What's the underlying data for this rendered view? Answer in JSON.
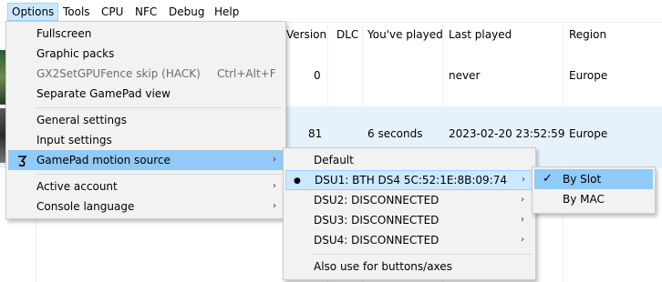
{
  "menubar": {
    "items": [
      "Options",
      "Tools",
      "CPU",
      "NFC",
      "Debug",
      "Help"
    ]
  },
  "gamelist": {
    "columns": [
      "Version",
      "DLC",
      "You've played",
      "Last played",
      "Region"
    ],
    "rows": [
      {
        "version": "0",
        "dlc": "",
        "played": "",
        "last_played": "never",
        "region": "Europe"
      },
      {
        "version": "81",
        "dlc": "",
        "played": "6 seconds",
        "last_played": "2023-02-20 23:52:59",
        "region": "Europe"
      }
    ]
  },
  "options_menu": {
    "items": [
      {
        "label": "Fullscreen"
      },
      {
        "label": "Graphic packs"
      },
      {
        "label": "GX2SetGPUFence skip (HACK)",
        "shortcut": "Ctrl+Alt+F",
        "disabled": true
      },
      {
        "label": "Separate GamePad view"
      },
      {
        "label": "General settings"
      },
      {
        "label": "Input settings"
      },
      {
        "label": "GamePad motion source",
        "submenu": true,
        "icon": "controller-icon",
        "highlighted": true
      },
      {
        "label": "Active account",
        "submenu": true
      },
      {
        "label": "Console language",
        "submenu": true
      }
    ]
  },
  "motion_menu": {
    "items": [
      {
        "label": "Default"
      },
      {
        "label": "DSU1: BTH DS4 5C:52:1E:8B:09:74",
        "submenu": true,
        "selected": true,
        "highlighted": true
      },
      {
        "label": "DSU2: DISCONNECTED",
        "submenu": true
      },
      {
        "label": "DSU3: DISCONNECTED",
        "submenu": true
      },
      {
        "label": "DSU4: DISCONNECTED",
        "submenu": true
      },
      {
        "label": "Also use for buttons/axes"
      }
    ]
  },
  "dsu_menu": {
    "items": [
      {
        "label": "By Slot",
        "checked": true,
        "highlighted": true
      },
      {
        "label": "By MAC"
      }
    ]
  },
  "glyphs": {
    "arrow": "›",
    "bullet": "●",
    "check": "✓"
  },
  "colors": {
    "menu_bg": "#f2f2f2",
    "highlight": "#91c9f7",
    "menubar_active": "#cce8ff",
    "row_selected": "#e6f2fb"
  }
}
